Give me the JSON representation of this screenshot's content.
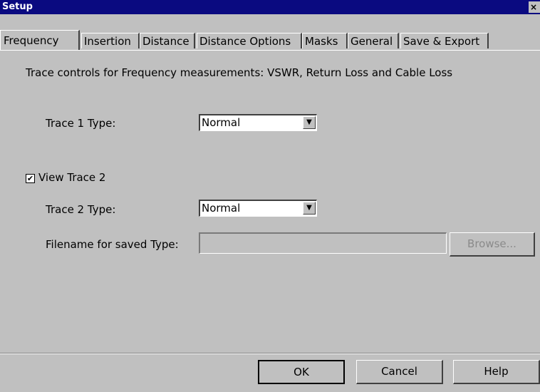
{
  "window": {
    "title": "Setup",
    "close_glyph": "×"
  },
  "tabs": [
    {
      "label": "Frequency",
      "active": true
    },
    {
      "label": "Insertion",
      "active": false
    },
    {
      "label": "Distance",
      "active": false
    },
    {
      "label": "Distance Options",
      "active": false
    },
    {
      "label": "Masks",
      "active": false
    },
    {
      "label": "General",
      "active": false
    },
    {
      "label": "Save & Export",
      "active": false
    }
  ],
  "frequency": {
    "description": "Trace controls for Frequency measurements: VSWR, Return Loss and Cable Loss",
    "trace1_label": "Trace 1 Type:",
    "trace1_value": "Normal",
    "view_trace2_label": "View Trace 2",
    "view_trace2_checked": true,
    "trace2_label": "Trace 2 Type:",
    "trace2_value": "Normal",
    "filename_label": "Filename for saved Type:",
    "filename_value": "",
    "browse_label": "Browse..."
  },
  "buttons": {
    "ok": "OK",
    "cancel": "Cancel",
    "help": "Help"
  },
  "icons": {
    "checkbox_check": "✔",
    "dropdown_arrow": "▼"
  }
}
